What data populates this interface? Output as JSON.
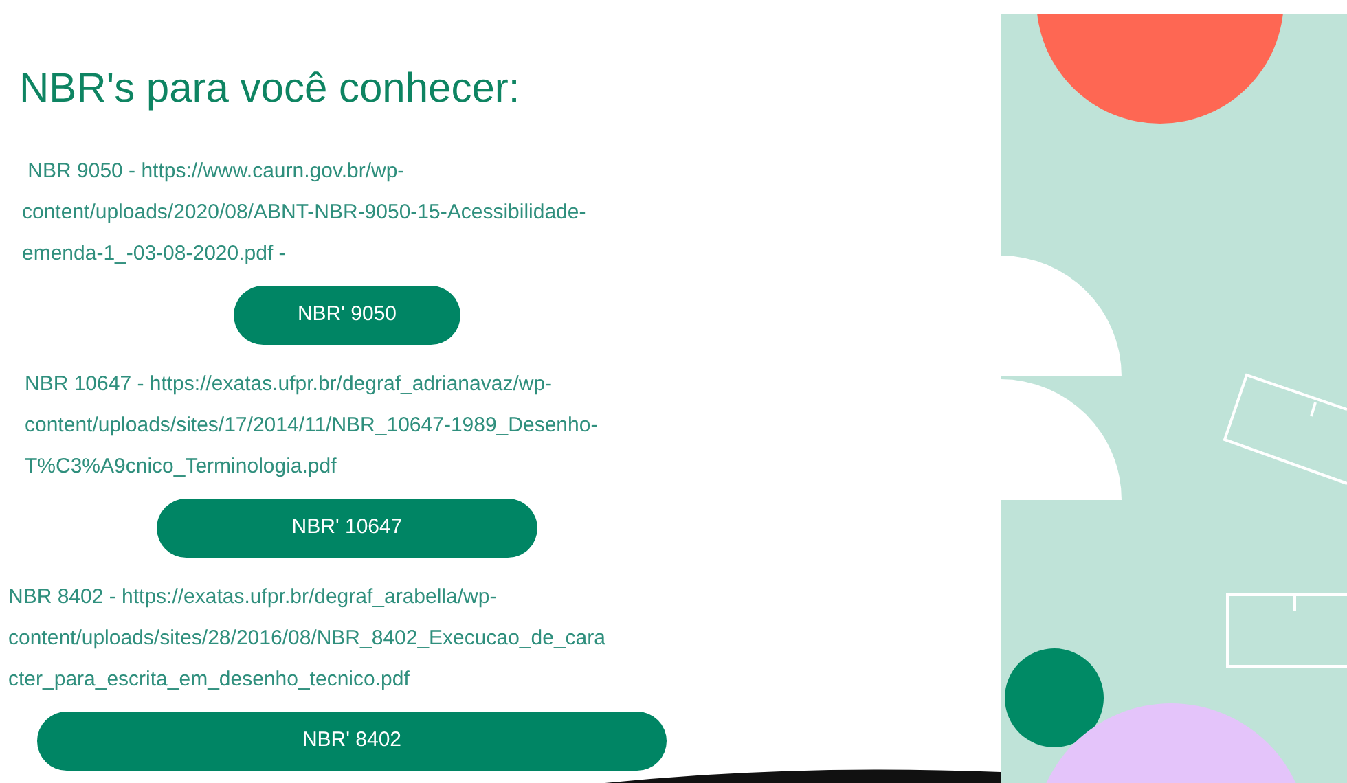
{
  "heading": "NBR's para você conhecer:",
  "entries": [
    {
      "lines": [
        " NBR 9050 - https://www.caurn.gov.br/wp-",
        "content/uploads/2020/08/ABNT-NBR-9050-15-Acessibilidade-",
        "emenda-1_-03-08-2020.pdf -"
      ],
      "button": "NBR' 9050"
    },
    {
      "lines": [
        "NBR 10647 - https://exatas.ufpr.br/degraf_adrianavaz/wp-",
        "content/uploads/sites/17/2014/11/NBR_10647-1989_Desenho-",
        "T%C3%A9cnico_Terminologia.pdf"
      ],
      "button": "NBR' 10647"
    },
    {
      "lines": [
        "NBR 8402 - https://exatas.ufpr.br/degraf_arabella/wp-",
        "content/uploads/sites/28/2016/08/NBR_8402_Execucao_de_cara",
        "cter_para_escrita_em_desenho_tecnico.pdf"
      ],
      "button": "NBR' 8402"
    }
  ]
}
